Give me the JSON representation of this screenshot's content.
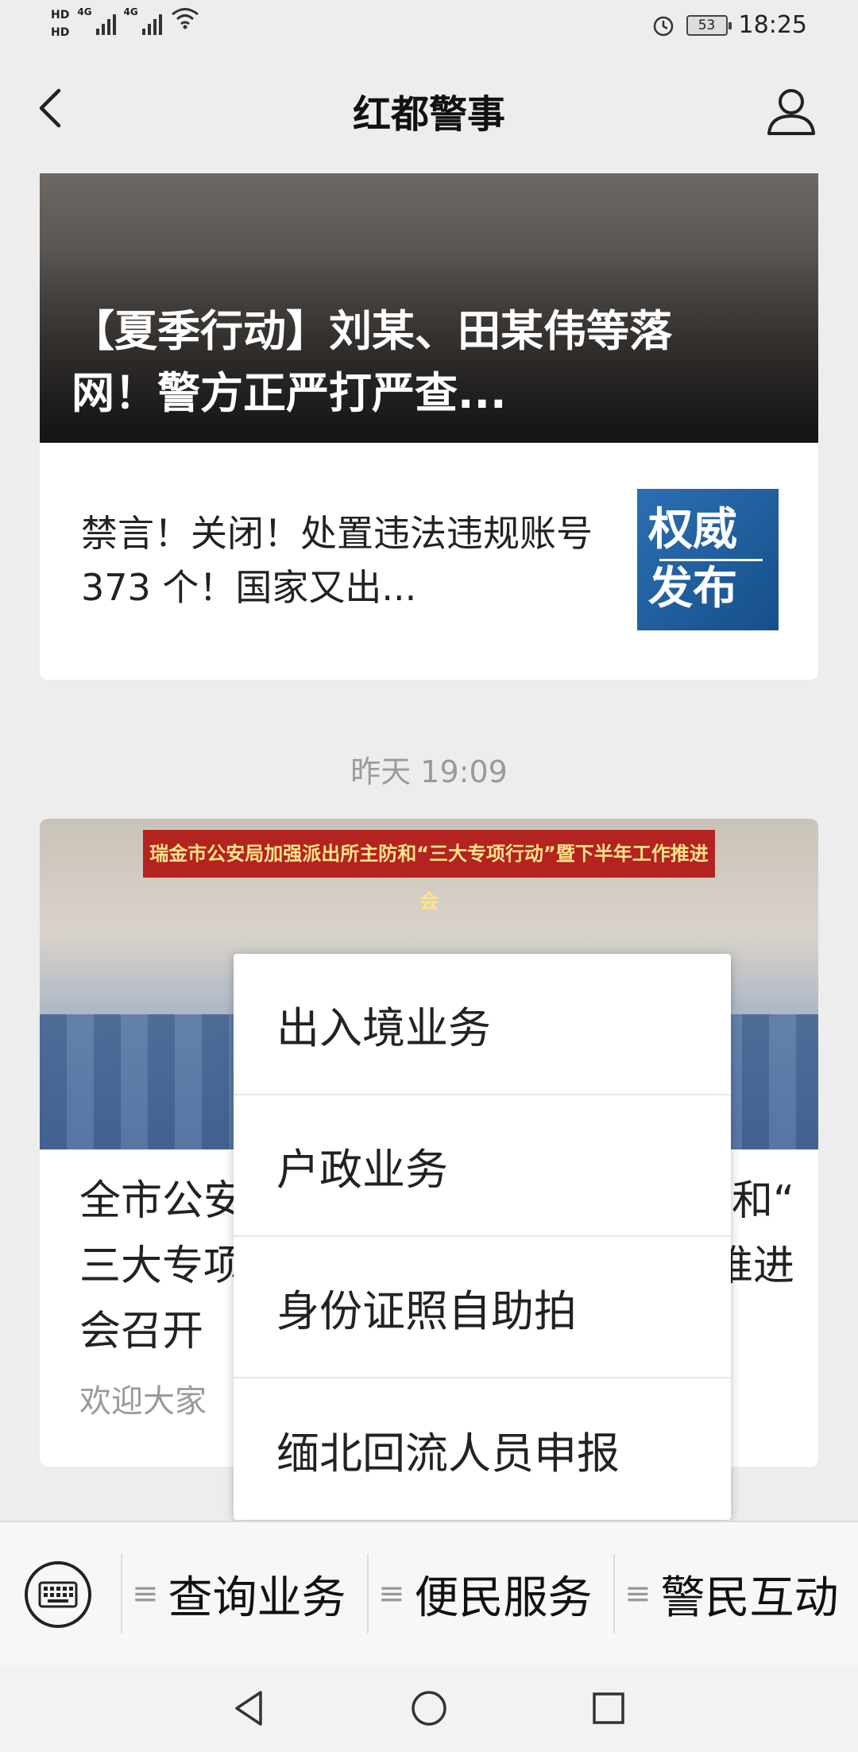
{
  "status": {
    "network_left": "HD",
    "signal1": "4G",
    "signal2": "4G",
    "battery": "53",
    "time": "18:25"
  },
  "header": {
    "title": "红都警事"
  },
  "articles": [
    {
      "title": "【夏季行动】刘某、田某伟等落网！警方正严打严查..."
    },
    {
      "title": "禁言！关闭！处置违法违规账号 373 个！国家又出...",
      "thumb_text_top": "权威",
      "thumb_text_bottom": "发布"
    }
  ],
  "time_label": "昨天 19:09",
  "article3": {
    "banner": "瑞金市公安局加强派出所主防和“三大专项行动”暨下半年工作推进会",
    "title_line1": "全市公安",
    "title_line1_right": "和“",
    "title_line2": "三大专项",
    "title_line2_right": "推进",
    "title_line3": "会召开",
    "summary": "欢迎大家"
  },
  "popup_menu": {
    "items": [
      "出入境业务",
      "户政业务",
      "身份证照自助拍",
      "缅北回流人员申报"
    ]
  },
  "bottom_menu": {
    "items": [
      "查询业务",
      "便民服务",
      "警民互动"
    ]
  }
}
